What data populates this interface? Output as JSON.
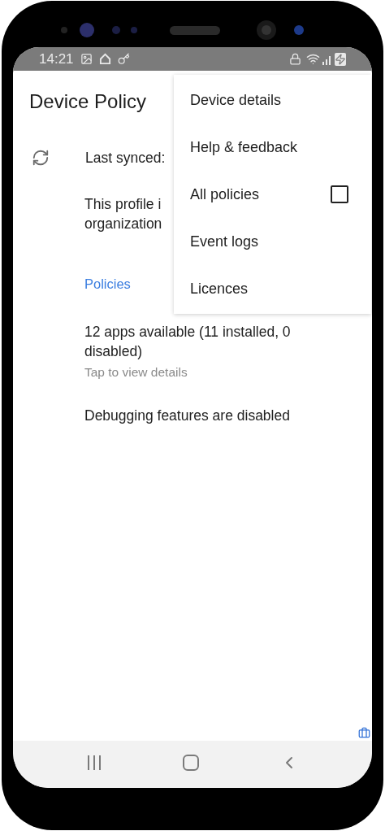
{
  "status_bar": {
    "time": "14:21"
  },
  "app_bar": {
    "title": "Device Policy"
  },
  "sync": {
    "label": "Last synced:"
  },
  "profile_note": {
    "lines": [
      "This profile i",
      "organization"
    ]
  },
  "section": {
    "title": "Policies"
  },
  "policies": [
    {
      "title": "12 apps available (11 installed, 0 disabled)",
      "subtitle": "Tap to view details"
    },
    {
      "title": "Debugging features are disabled"
    }
  ],
  "menu": [
    {
      "kind": "item",
      "label": "Device details"
    },
    {
      "kind": "item",
      "label": "Help & feedback"
    },
    {
      "kind": "checkbox",
      "label": "All policies",
      "checked": false
    },
    {
      "kind": "item",
      "label": "Event logs"
    },
    {
      "kind": "item",
      "label": "Licences"
    }
  ]
}
